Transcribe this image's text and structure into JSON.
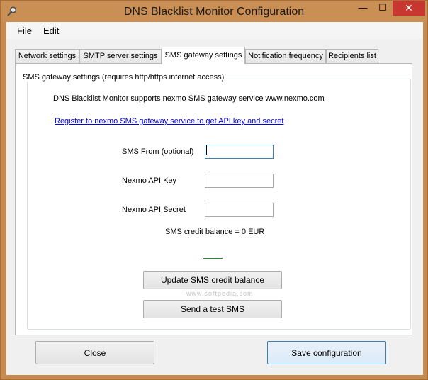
{
  "window": {
    "title": "DNS Blacklist Monitor Configuration",
    "minimize_glyph": "—",
    "maximize_glyph": "☐",
    "close_glyph": "✕"
  },
  "menu": {
    "file": "File",
    "edit": "Edit"
  },
  "tabs": [
    {
      "label": "Network settings",
      "active": false
    },
    {
      "label": "SMTP server settings",
      "active": false
    },
    {
      "label": "SMS gateway settings",
      "active": true
    },
    {
      "label": "Notification frequency",
      "active": false
    },
    {
      "label": "Recipients list",
      "active": false
    }
  ],
  "sms": {
    "group_title": "SMS gateway settings (requires http/https internet access)",
    "intro": "DNS Blacklist Monitor supports nexmo SMS gateway service www.nexmo.com",
    "register_link": "Register to nexmo SMS gateway service to get API key and secret",
    "from_label": "SMS From (optional)",
    "from_value": "",
    "api_key_label": "Nexmo API Key",
    "api_key_value": "",
    "api_secret_label": "Nexmo API Secret",
    "api_secret_value": "",
    "balance_text": "SMS credit balance = 0 EUR",
    "update_button": "Update SMS credit balance",
    "test_button": "Send a test SMS",
    "watermark": "www.softpedia.com"
  },
  "footer": {
    "close_button": "Close",
    "save_button": "Save configuration"
  },
  "colors": {
    "title_bar": "#c98f55",
    "close_button": "#c7372f",
    "link": "#0000e8",
    "focus_border": "#3c7fb1",
    "status_line": "#1c8a2a"
  }
}
